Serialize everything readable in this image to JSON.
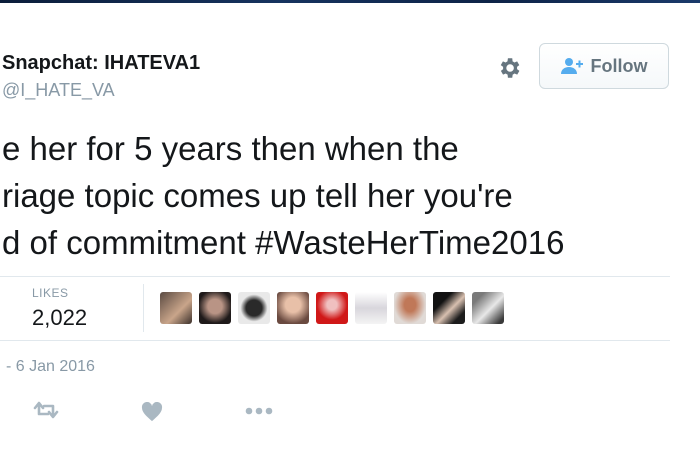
{
  "colors": {
    "text": "#14171a",
    "secondary_text": "#8899a6",
    "divider": "#e1e8ed",
    "follow_border": "#cfd9de",
    "follow_text": "#66757f",
    "icon_gray": "#8899a6",
    "follow_icon_blue": "#55acee"
  },
  "author": {
    "display_name": "Snapchat: IHATEVA1",
    "handle": "@I_HATE_VA"
  },
  "header_actions": {
    "settings_icon": "gear-icon",
    "follow_icon": "add-user-icon",
    "follow_label": "Follow"
  },
  "tweet": {
    "lines": [
      "e her for 5 years then when the",
      "riage topic comes up tell her you're"
    ],
    "line3_text": "d of commitment ",
    "hashtag": "#WasteHerTime2016"
  },
  "stats": {
    "likes_label": "LIKES",
    "likes_count": "2,022",
    "liker_avatar_count": 9
  },
  "timestamp": "- 6 Jan 2016",
  "actions": {
    "retweet_icon": "retweet-icon",
    "like_icon": "heart-icon",
    "more_icon": "more-dots-icon"
  }
}
